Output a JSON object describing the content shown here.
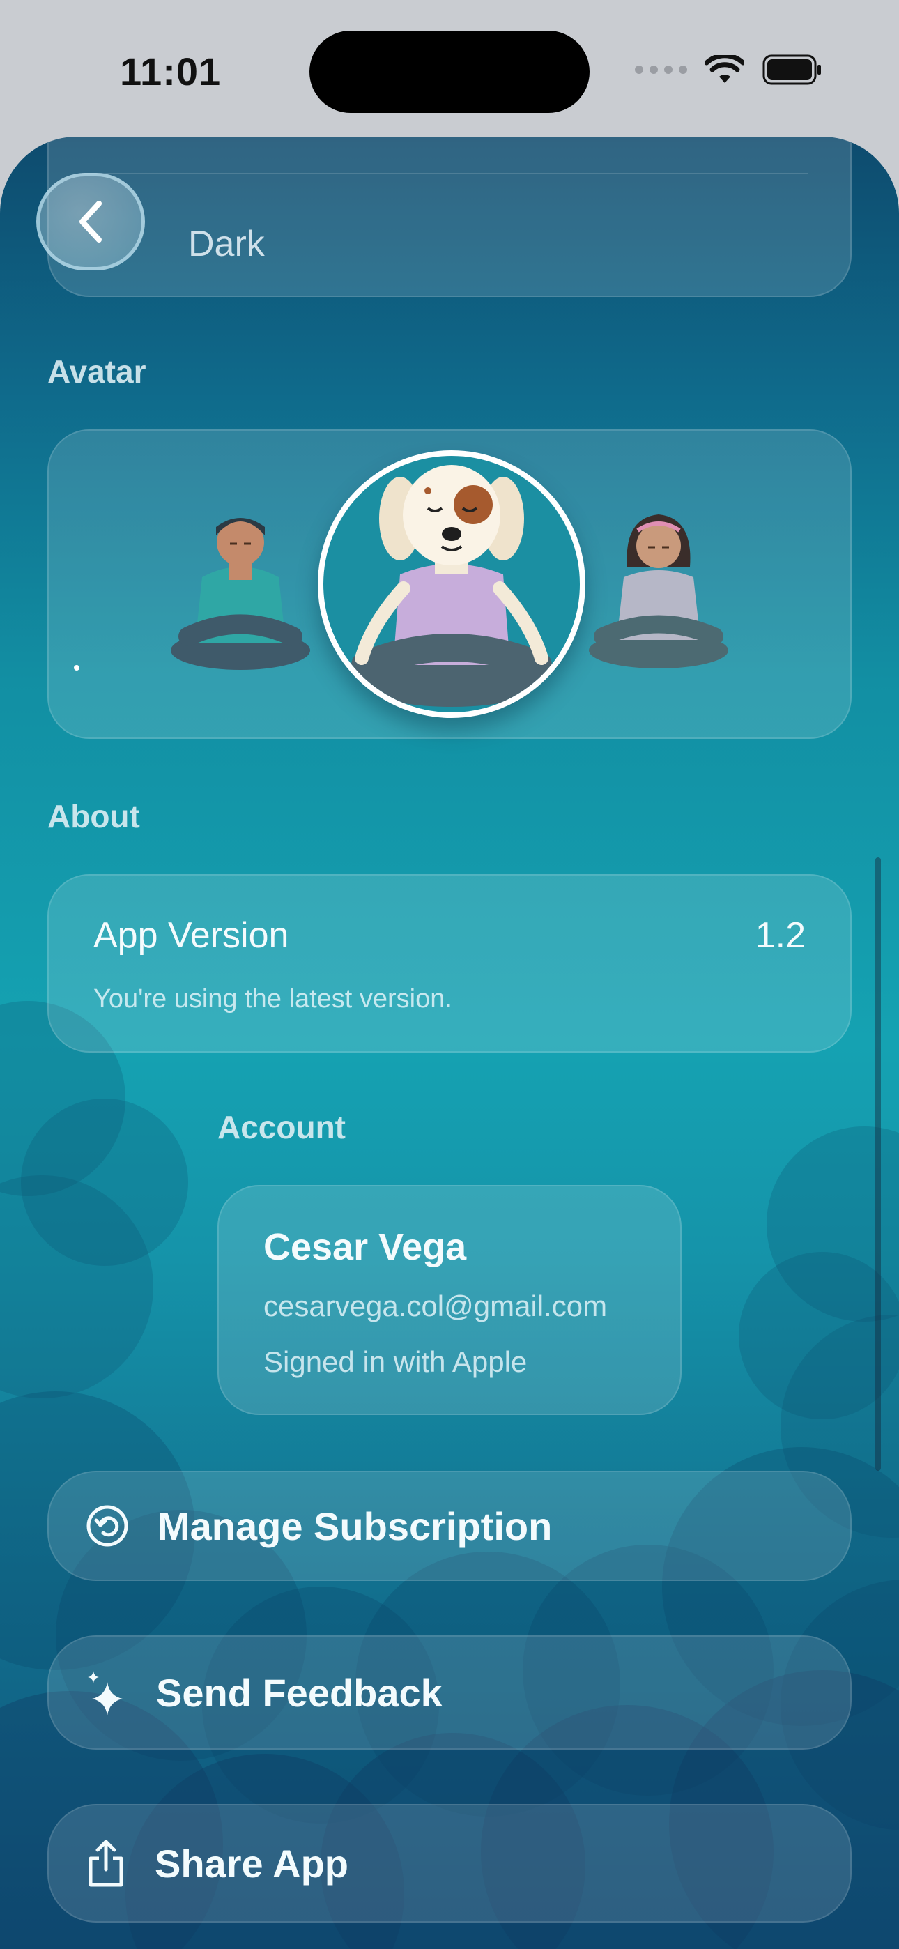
{
  "status_bar": {
    "time": "11:01"
  },
  "theme_card": {
    "value": "Dark"
  },
  "avatar_section": {
    "title": "Avatar",
    "options": [
      "man-meditating",
      "dog-meditating",
      "girl-meditating"
    ],
    "selected": "dog-meditating"
  },
  "about_section": {
    "title": "About",
    "app_version_label": "App Version",
    "app_version_value": "1.2",
    "app_version_note": "You're using the latest version."
  },
  "account_section": {
    "title": "Account",
    "name": "Cesar Vega",
    "email": "cesarvega.col@gmail.com",
    "sign_in_method": "Signed in with Apple"
  },
  "actions": {
    "manage_subscription": "Manage Subscription",
    "send_feedback": "Send Feedback",
    "share_app": "Share App"
  },
  "colors": {
    "background_top": "#0e4b6e",
    "background_mid": "#15a2b2",
    "background_bottom": "#0e4f76",
    "text": "#f4fbfd"
  }
}
